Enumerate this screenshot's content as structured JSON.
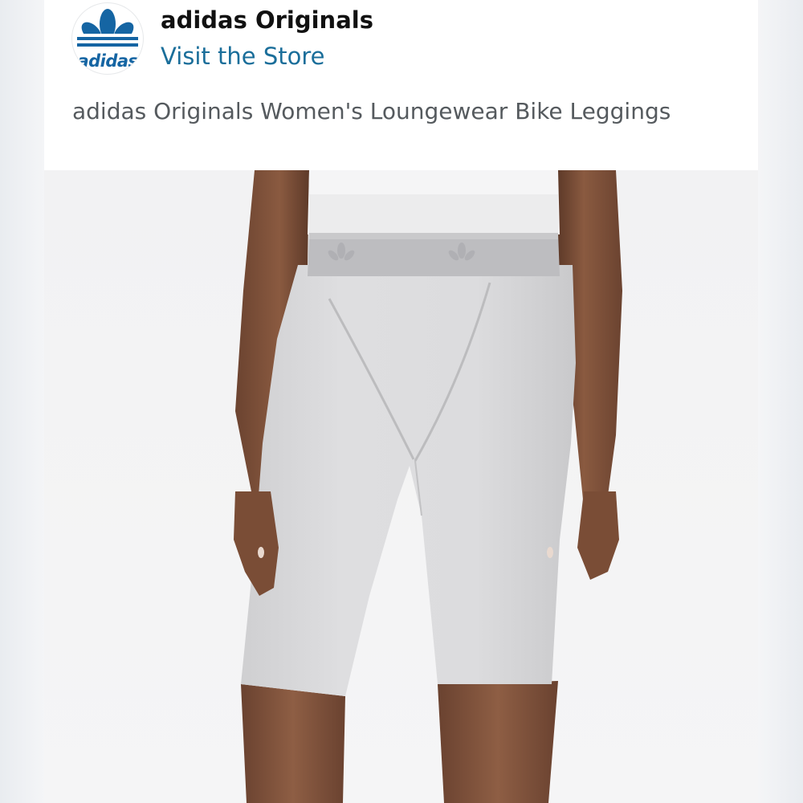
{
  "brand": {
    "name": "adidas Originals",
    "logo_text": "adidas",
    "store_link": "Visit the Store"
  },
  "product": {
    "title": "adidas Originals Women's Loungewear Bike Leggings"
  },
  "icons": {
    "logo": "adidas-trefoil-icon"
  },
  "colors": {
    "brand_blue": "#1565a3",
    "link": "#1a6e9a",
    "title_text": "#555a5e"
  }
}
